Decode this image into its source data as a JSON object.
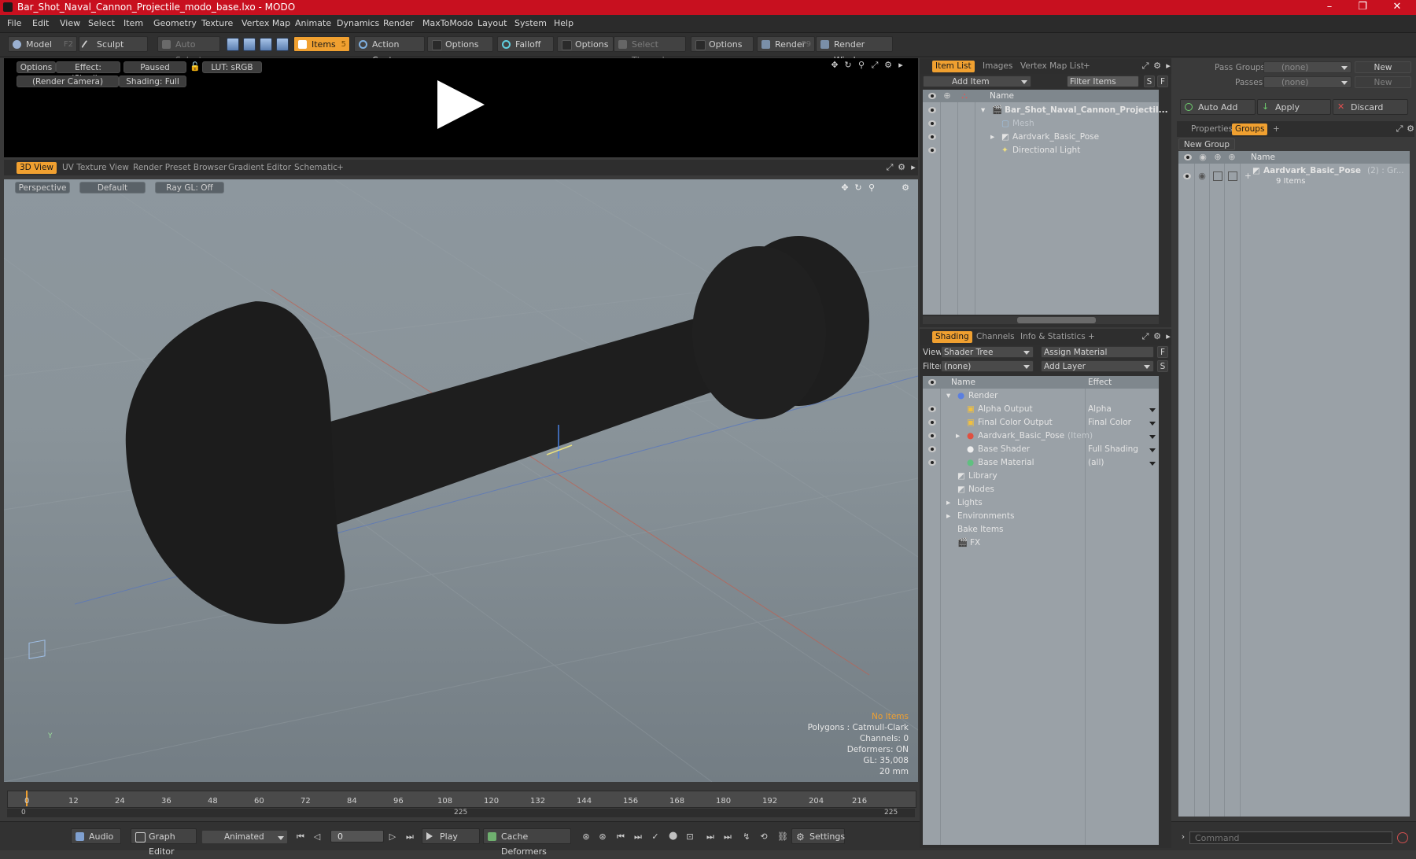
{
  "window": {
    "title": "Bar_Shot_Naval_Cannon_Projectile_modo_base.lxo - MODO",
    "minimize": "–",
    "maximize": "❐",
    "close": "✕"
  },
  "menu": [
    "File",
    "Edit",
    "View",
    "Select",
    "Item",
    "Geometry",
    "Texture",
    "Vertex Map",
    "Animate",
    "Dynamics",
    "Render",
    "MaxToModo",
    "Layout",
    "System",
    "Help"
  ],
  "toolbar": {
    "model": "Model",
    "model_key": "F2",
    "sculpt": "Sculpt",
    "auto_select": "Auto Select",
    "items": "Items",
    "items_key": "5",
    "action_center": "Action Center",
    "options1": "Options",
    "falloff": "Falloff",
    "options2": "Options",
    "select_through": "Select Through",
    "options3": "Options",
    "render": "Render",
    "render_key": "F9",
    "render_window": "Render Window"
  },
  "preview": {
    "options": "Options",
    "effect": "Effect: (Shadi...",
    "paused": "Paused",
    "lut": "LUT: sRGB",
    "camera": "(Render Camera)",
    "shading": "Shading: Full"
  },
  "view_tabs": [
    "3D View",
    "UV Texture View",
    "Render Preset Browser",
    "Gradient Editor",
    "Schematic"
  ],
  "view_tab_add": "+",
  "viewport": {
    "perspective": "Perspective",
    "default": "Default",
    "raygl": "Ray GL: Off",
    "info_title": "No Items",
    "info_lines": [
      "Polygons : Catmull-Clark",
      "Channels: 0",
      "Deformers: ON",
      "GL: 35,008",
      "20 mm"
    ],
    "axis_y": "Y",
    "accent": "#f0a030"
  },
  "timeline": {
    "ticks": [
      "0",
      "12",
      "24",
      "36",
      "48",
      "60",
      "72",
      "84",
      "96",
      "108",
      "120",
      "132",
      "144",
      "156",
      "168",
      "180",
      "192",
      "204",
      "216"
    ],
    "start": "0",
    "mid": "225",
    "end": "225"
  },
  "bottom": {
    "audio": "Audio",
    "graph_editor": "Graph Editor",
    "animated": "Animated",
    "frame": "0",
    "play": "Play",
    "cache_deformers": "Cache Deformers",
    "settings": "Settings",
    "command_placeholder": "Command"
  },
  "item_list": {
    "tabs": [
      "Item List",
      "Images",
      "Vertex Map List"
    ],
    "tab_add": "+",
    "add_item": "Add Item",
    "filter_items": "Filter Items",
    "s": "S",
    "f": "F",
    "col_name": "Name",
    "rows": [
      {
        "label": "Bar_Shot_Naval_Cannon_Projectil...",
        "bold": true
      },
      {
        "label": "Mesh",
        "dim": true
      },
      {
        "label": "Aardvark_Basic_Pose"
      },
      {
        "label": "Directional Light"
      }
    ]
  },
  "shading": {
    "tabs": [
      "Shading",
      "Channels",
      "Info & Statistics"
    ],
    "tab_add": "+",
    "view_label": "View",
    "view_value": "Shader Tree",
    "assign_material": "Assign Material",
    "f": "F",
    "filter_label": "Filter",
    "filter_value": "(none)",
    "add_layer": "Add Layer",
    "s": "S",
    "col_name": "Name",
    "col_effect": "Effect",
    "rows": [
      {
        "label": "Render",
        "effect": ""
      },
      {
        "label": "Alpha Output",
        "effect": "Alpha"
      },
      {
        "label": "Final Color Output",
        "effect": "Final Color"
      },
      {
        "label": "Aardvark_Basic_Pose",
        "suffix": "(Item)",
        "effect": ""
      },
      {
        "label": "Base Shader",
        "effect": "Full Shading"
      },
      {
        "label": "Base Material",
        "effect": "(all)"
      },
      {
        "label": "Library",
        "effect": ""
      },
      {
        "label": "Nodes",
        "effect": ""
      },
      {
        "label": "Lights",
        "effect": ""
      },
      {
        "label": "Environments",
        "effect": ""
      },
      {
        "label": "Bake Items",
        "effect": ""
      },
      {
        "label": "FX",
        "effect": ""
      }
    ]
  },
  "groups_panel": {
    "pass_groups": "Pass Groups",
    "pass_groups_value": "(none)",
    "new": "New",
    "passes": "Passes",
    "passes_value": "(none)",
    "new2": "New",
    "auto_add": "Auto Add",
    "apply": "Apply",
    "discard": "Discard",
    "tabs": [
      "Properties",
      "Groups"
    ],
    "tab_add": "+",
    "new_group": "New Group",
    "col_name": "Name",
    "group_name": "Aardvark_Basic_Pose",
    "group_suffix": "(2) : Gr...",
    "group_items": "9 Items"
  }
}
